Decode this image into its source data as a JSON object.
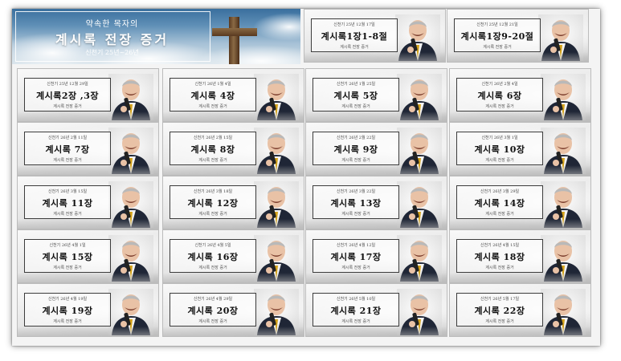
{
  "banner": {
    "top_text": "약속한 목자의",
    "title": "계시록 전장 증거",
    "subtitle": "신천기 25년~26년"
  },
  "thumb_subtitle": "계시록 전장 증거",
  "icons": {
    "banner_image": "cross-in-sky",
    "thumbnail_image": "speaker-portrait"
  },
  "videos": [
    {
      "date": "신천기 25년 12월 17일",
      "title": "계시록1장1-8절"
    },
    {
      "date": "신천기 25년 12월 21일",
      "title": "계시록1장9-20절"
    },
    {
      "date": "신천기 25년 12월 29일",
      "title": "계시록2장 ,3장"
    },
    {
      "date": "신천기 26년 1월 4일",
      "title": "계시록 4장"
    },
    {
      "date": "신천기 26년 1월 25일",
      "title": "계시록 5장"
    },
    {
      "date": "신천기 26년 2월 4일",
      "title": "계시록 6장"
    },
    {
      "date": "신천기 26년 2월 11일",
      "title": "계시록 7장"
    },
    {
      "date": "신천기 26년 2월 15일",
      "title": "계시록 8장"
    },
    {
      "date": "신천기 26년 2월 22일",
      "title": "계시록 9장"
    },
    {
      "date": "신천기 26년 3월 1일",
      "title": "계시록 10장"
    },
    {
      "date": "신천기 26년 3월 15일",
      "title": "계시록 11장"
    },
    {
      "date": "신천기 26년 3월 18일",
      "title": "계시록 12장"
    },
    {
      "date": "신천기 26년 3월 22일",
      "title": "계시록 13장"
    },
    {
      "date": "신천기 26년 3월 29일",
      "title": "계시록 14장"
    },
    {
      "date": "신천기 26년 4월 1일",
      "title": "계시록 15장"
    },
    {
      "date": "신천기 26년 4월 5일",
      "title": "계시록 16장"
    },
    {
      "date": "신천기 26년 4월 12일",
      "title": "계시록 17장"
    },
    {
      "date": "신천기 26년 4월 15일",
      "title": "계시록 18장"
    },
    {
      "date": "신천기 26년 4월 19일",
      "title": "계시록 19장"
    },
    {
      "date": "신천기 26년 4월 29일",
      "title": "계시록 20장"
    },
    {
      "date": "신천기 26년 5월 10일",
      "title": "계시록 21장"
    },
    {
      "date": "신천기 26년 5월 17일",
      "title": "계시록 22장"
    }
  ]
}
